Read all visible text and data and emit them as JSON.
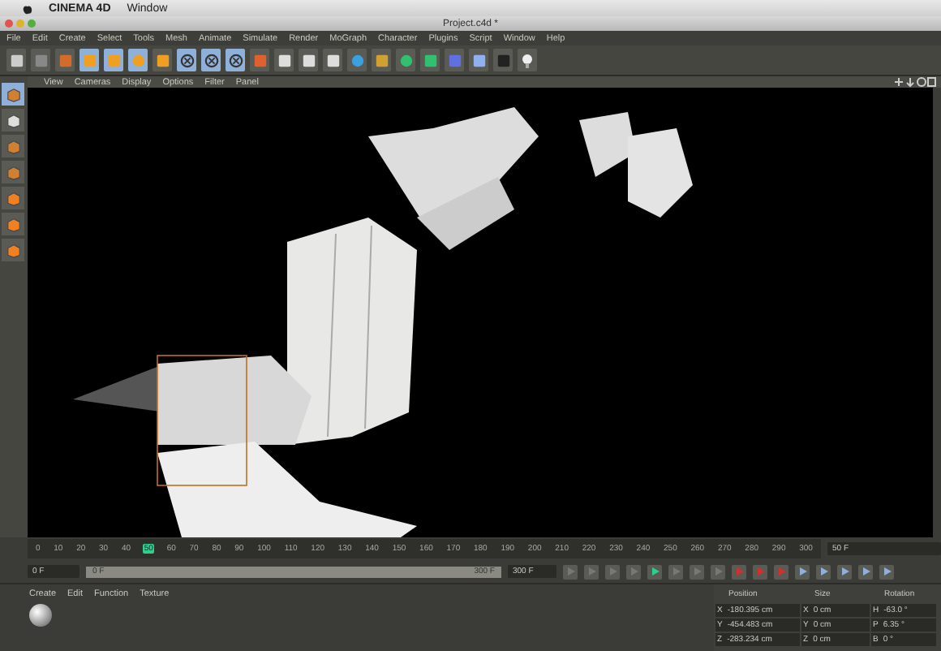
{
  "os_menu": {
    "app": "CINEMA 4D",
    "items": [
      "Window"
    ]
  },
  "window": {
    "title": "Project.c4d *"
  },
  "menu": [
    "File",
    "Edit",
    "Create",
    "Select",
    "Tools",
    "Mesh",
    "Animate",
    "Simulate",
    "Render",
    "MoGraph",
    "Character",
    "Plugins",
    "Script",
    "Window",
    "Help"
  ],
  "toolbar": [
    {
      "kind": "undo",
      "selected": false
    },
    {
      "kind": "redo",
      "selected": false
    },
    {
      "kind": "select",
      "selected": false
    },
    {
      "kind": "move",
      "selected": true
    },
    {
      "kind": "scale",
      "selected": true
    },
    {
      "kind": "rotate",
      "selected": true
    },
    {
      "kind": "add",
      "selected": false
    },
    {
      "kind": "x",
      "selected": true
    },
    {
      "kind": "y",
      "selected": true
    },
    {
      "kind": "z",
      "selected": true
    },
    {
      "kind": "coords",
      "selected": false
    },
    {
      "kind": "render",
      "selected": false
    },
    {
      "kind": "render",
      "selected": false
    },
    {
      "kind": "render",
      "selected": false
    },
    {
      "kind": "cube",
      "selected": false
    },
    {
      "kind": "spline",
      "selected": false
    },
    {
      "kind": "nurbs",
      "selected": false
    },
    {
      "kind": "array",
      "selected": false
    },
    {
      "kind": "deformer",
      "selected": false
    },
    {
      "kind": "floor",
      "selected": false
    },
    {
      "kind": "camera",
      "selected": false
    },
    {
      "kind": "light",
      "selected": false
    }
  ],
  "viewport": {
    "menu": [
      "View",
      "Cameras",
      "Display",
      "Options",
      "Filter",
      "Panel"
    ]
  },
  "side_tools": [
    {
      "kind": "model",
      "selected": true
    },
    {
      "kind": "texture",
      "selected": false
    },
    {
      "kind": "points",
      "selected": false
    },
    {
      "kind": "edges",
      "selected": false
    },
    {
      "kind": "polygons",
      "selected": false
    },
    {
      "kind": "axis",
      "selected": false
    },
    {
      "kind": "magnet",
      "selected": false
    }
  ],
  "timeline": {
    "ticks": [
      {
        "label": "0",
        "selected": false
      },
      {
        "label": "10",
        "selected": false
      },
      {
        "label": "20",
        "selected": false
      },
      {
        "label": "30",
        "selected": false
      },
      {
        "label": "40",
        "selected": false
      },
      {
        "label": "50",
        "selected": true
      },
      {
        "label": "60",
        "selected": false
      },
      {
        "label": "70",
        "selected": false
      },
      {
        "label": "80",
        "selected": false
      },
      {
        "label": "90",
        "selected": false
      },
      {
        "label": "100",
        "selected": false
      },
      {
        "label": "110",
        "selected": false
      },
      {
        "label": "120",
        "selected": false
      },
      {
        "label": "130",
        "selected": false
      },
      {
        "label": "140",
        "selected": false
      },
      {
        "label": "150",
        "selected": false
      },
      {
        "label": "160",
        "selected": false
      },
      {
        "label": "170",
        "selected": false
      },
      {
        "label": "180",
        "selected": false
      },
      {
        "label": "190",
        "selected": false
      },
      {
        "label": "200",
        "selected": false
      },
      {
        "label": "210",
        "selected": false
      },
      {
        "label": "220",
        "selected": false
      },
      {
        "label": "230",
        "selected": false
      },
      {
        "label": "240",
        "selected": false
      },
      {
        "label": "250",
        "selected": false
      },
      {
        "label": "260",
        "selected": false
      },
      {
        "label": "270",
        "selected": false
      },
      {
        "label": "280",
        "selected": false
      },
      {
        "label": "290",
        "selected": false
      },
      {
        "label": "300",
        "selected": false
      }
    ],
    "current_frame": "50 F",
    "start_frame": "0 F",
    "range_start": "0 F",
    "range_end": "300 F",
    "end_frame": "300 F"
  },
  "materials": {
    "menu": [
      "Create",
      "Edit",
      "Function",
      "Texture"
    ]
  },
  "coordinates": {
    "headers": [
      "Position",
      "Size",
      "Rotation"
    ],
    "rows": [
      {
        "axis": "X",
        "position": "-180.395 cm",
        "size_axis": "X",
        "size": "0 cm",
        "rot_axis": "H",
        "rotation": "-63.0 °"
      },
      {
        "axis": "Y",
        "position": "-454.483 cm",
        "size_axis": "Y",
        "size": "0 cm",
        "rot_axis": "P",
        "rotation": "6.35 °"
      },
      {
        "axis": "Z",
        "position": "-283.234 cm",
        "size_axis": "Z",
        "size": "0 cm",
        "rot_axis": "B",
        "rotation": "0 °"
      }
    ]
  }
}
